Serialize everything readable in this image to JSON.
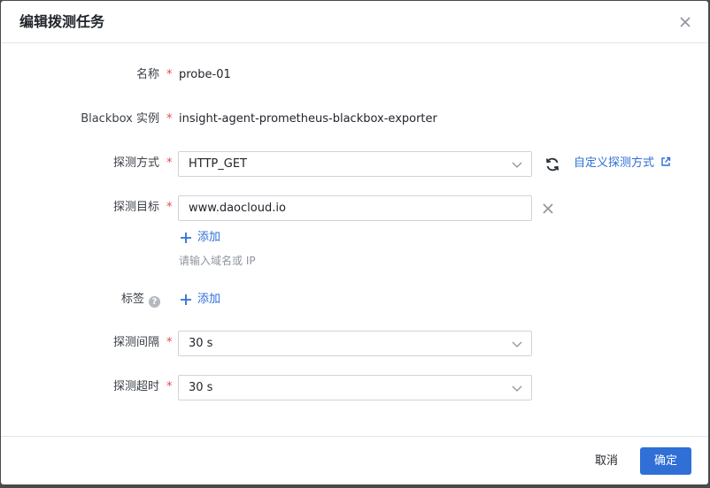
{
  "dialog": {
    "title": "编辑拨测任务",
    "close_icon": "close-icon"
  },
  "form": {
    "required_mark": "*",
    "name": {
      "label": "名称",
      "value": "probe-01"
    },
    "blackbox": {
      "label": "Blackbox 实例",
      "value": "insight-agent-prometheus-blackbox-exporter"
    },
    "method": {
      "label": "探测方式",
      "value": "HTTP_GET",
      "refresh_icon": "refresh-icon",
      "custom_link": "自定义探测方式",
      "external_icon": "external-link-icon"
    },
    "target": {
      "label": "探测目标",
      "value": "www.daocloud.io",
      "add_label": "添加",
      "hint": "请输入域名或 IP"
    },
    "tags": {
      "label": "标签",
      "help_icon": "question-icon",
      "add_label": "添加"
    },
    "interval": {
      "label": "探测间隔",
      "value": "30 s"
    },
    "timeout": {
      "label": "探测超时",
      "value": "30 s"
    }
  },
  "footer": {
    "cancel_label": "取消",
    "ok_label": "确定"
  },
  "colors": {
    "primary": "#2f6fd6",
    "required": "#e5484d",
    "border": "#cfd3d8",
    "hint": "#8f959e"
  }
}
